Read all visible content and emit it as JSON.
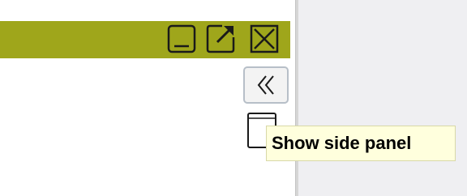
{
  "colors": {
    "title_bar": "#9fa61b",
    "left_panel": "#ffffff",
    "right_panel": "#efeff2",
    "tooltip_bg": "#ffffdd"
  },
  "title_bar": {
    "buttons": [
      {
        "icon": "minimize-icon"
      },
      {
        "icon": "popout-icon"
      },
      {
        "icon": "close-icon"
      }
    ]
  },
  "collapse_button": {
    "icon": "double-chevron-left-icon"
  },
  "side_panel_icon": {
    "icon": "side-panel-icon"
  },
  "tooltip": {
    "text": "Show side panel"
  }
}
